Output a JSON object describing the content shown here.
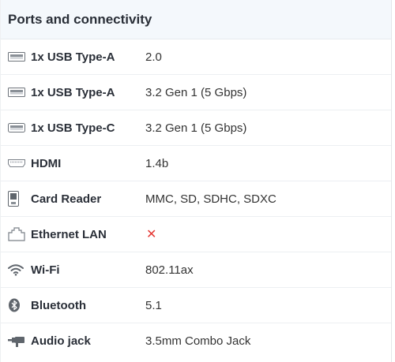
{
  "section": {
    "title": "Ports and connectivity"
  },
  "rows": [
    {
      "icon": "usb-a-port-icon",
      "label": "1x USB Type-A",
      "value": "2.0"
    },
    {
      "icon": "usb-a-port-icon",
      "label": "1x USB Type-A",
      "value": "3.2 Gen 1 (5 Gbps)"
    },
    {
      "icon": "usb-c-port-icon",
      "label": "1x USB Type-C",
      "value": "3.2 Gen 1 (5 Gbps)"
    },
    {
      "icon": "hdmi-port-icon",
      "label": "HDMI",
      "value": "1.4b"
    },
    {
      "icon": "sd-card-icon",
      "label": "Card Reader",
      "value": "MMC, SD, SDHC, SDXC"
    },
    {
      "icon": "ethernet-port-icon",
      "label": "Ethernet LAN",
      "value": "✕",
      "value_color": "#e53935"
    },
    {
      "icon": "wifi-icon",
      "label": "Wi-Fi",
      "value": "802.11ax"
    },
    {
      "icon": "bluetooth-icon",
      "label": "Bluetooth",
      "value": "5.1"
    },
    {
      "icon": "audio-jack-icon",
      "label": "Audio jack",
      "value": "3.5mm Combo Jack"
    }
  ]
}
